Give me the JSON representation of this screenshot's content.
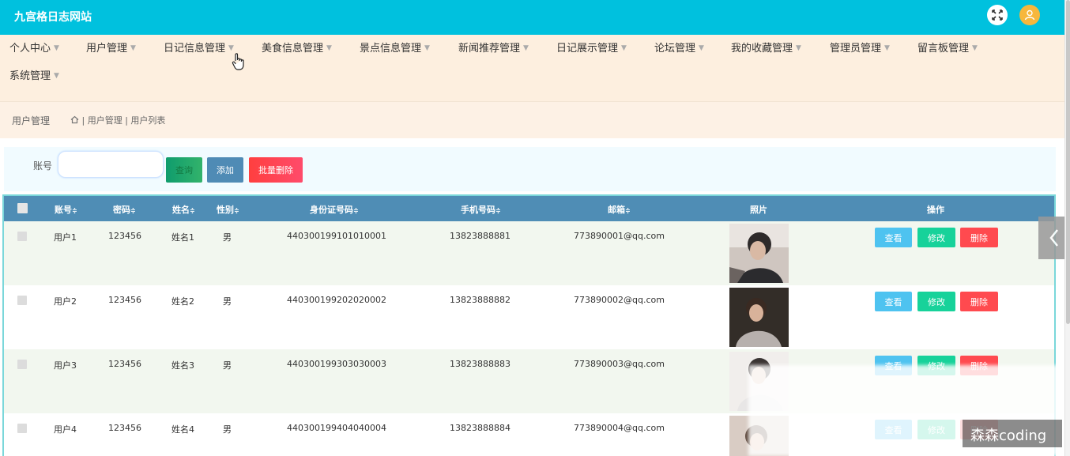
{
  "app": {
    "title": "九宫格日志网站"
  },
  "menu": {
    "items": [
      {
        "label": "个人中心"
      },
      {
        "label": "用户管理"
      },
      {
        "label": "日记信息管理"
      },
      {
        "label": "美食信息管理"
      },
      {
        "label": "景点信息管理"
      },
      {
        "label": "新闻推荐管理"
      },
      {
        "label": "日记展示管理"
      },
      {
        "label": "论坛管理"
      },
      {
        "label": "我的收藏管理"
      },
      {
        "label": "管理员管理"
      },
      {
        "label": "留言板管理"
      },
      {
        "label": "系统管理"
      }
    ]
  },
  "breadcrumb": {
    "page_title": "用户管理",
    "path": "| 用户管理 | 用户列表"
  },
  "search": {
    "account_label": "账号",
    "account_value": "",
    "query_label": "查询",
    "add_label": "添加",
    "batch_delete_label": "批量删除"
  },
  "table": {
    "headers": [
      {
        "label": "账号",
        "sortable": true
      },
      {
        "label": "密码",
        "sortable": true
      },
      {
        "label": "姓名",
        "sortable": true
      },
      {
        "label": "性别",
        "sortable": true
      },
      {
        "label": "身份证号码",
        "sortable": true
      },
      {
        "label": "手机号码",
        "sortable": true
      },
      {
        "label": "邮箱",
        "sortable": true
      },
      {
        "label": "照片",
        "sortable": false
      },
      {
        "label": "操作",
        "sortable": false
      }
    ],
    "sort_glyph": "≑",
    "rows": [
      {
        "account": "用户1",
        "password": "123456",
        "name": "姓名1",
        "gender": "男",
        "id_number": "440300199101010001",
        "phone": "13823888881",
        "email": "773890001@qq.com"
      },
      {
        "account": "用户2",
        "password": "123456",
        "name": "姓名2",
        "gender": "男",
        "id_number": "440300199202020002",
        "phone": "13823888882",
        "email": "773890002@qq.com"
      },
      {
        "account": "用户3",
        "password": "123456",
        "name": "姓名3",
        "gender": "男",
        "id_number": "440300199303030003",
        "phone": "13823888883",
        "email": "773890003@qq.com"
      },
      {
        "account": "用户4",
        "password": "123456",
        "name": "姓名4",
        "gender": "男",
        "id_number": "440300199404040004",
        "phone": "13823888884",
        "email": "773890004@qq.com"
      }
    ],
    "actions": {
      "view": "查看",
      "edit": "修改",
      "delete": "删除"
    }
  },
  "watermark": {
    "text": "森森coding"
  },
  "colors": {
    "topbar": "#00c1de",
    "menu_bg": "#fdefdf",
    "table_header": "#4f8db5",
    "view": "#4ec3f0",
    "edit": "#17d29a",
    "delete": "#ff4a4f"
  }
}
